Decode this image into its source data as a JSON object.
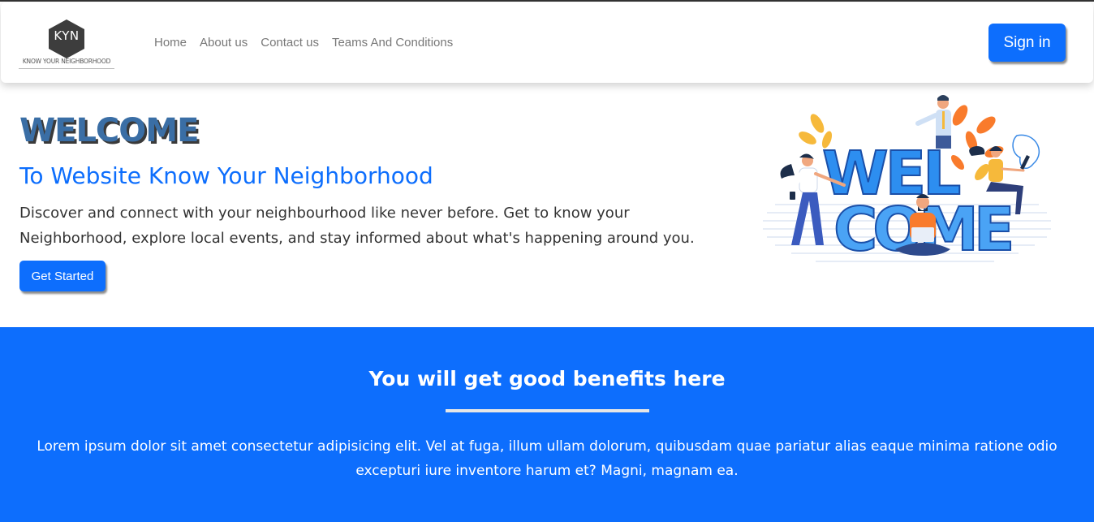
{
  "navbar": {
    "logo": {
      "initials": "KYN",
      "tagline": "KNOW YOUR NEIGHBORHOOD"
    },
    "links": [
      "Home",
      "About us",
      "Contact us",
      "Teams And Conditions"
    ],
    "signin_label": "Sign in"
  },
  "hero": {
    "title": "WELCOME",
    "subtitle": "To Website Know Your Neighborhood",
    "description": "Discover and connect with your neighbourhood like never before. Get to know your Neighborhood, explore local events, and stay informed about what's happening around you.",
    "cta_label": "Get Started",
    "illustration": {
      "line1": "WEL",
      "line2": "COME"
    }
  },
  "benefits": {
    "title": "You will get good benefits here",
    "text": "Lorem ipsum dolor sit amet consectetur adipisicing elit. Vel at fuga, illum ullam dolorum, quibusdam quae pariatur alias eaque minima ratione odio excepturi iure inventore harum et? Magni, magnam ea."
  },
  "colors": {
    "primary": "#0d6efd",
    "title_blue": "#3a6ea5",
    "nav_text": "#777777",
    "logo_dark": "#3d3d3d",
    "leaf_orange": "#f97b2c",
    "leaf_yellow": "#f6b93b",
    "letters_blue": "#2d8ef0"
  }
}
